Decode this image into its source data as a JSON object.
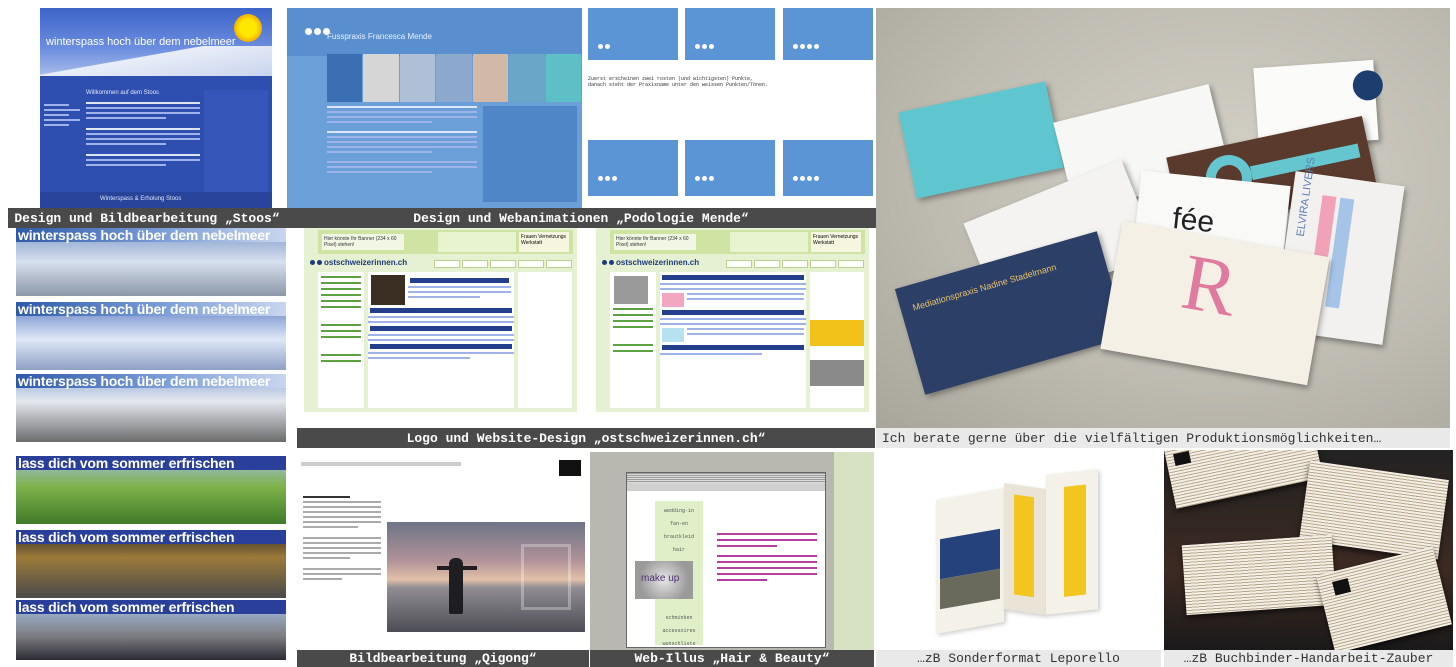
{
  "captions": {
    "stoos": "Design und Bildbearbeitung „Stoos“",
    "podologie": "Design und Webanimationen „Podologie Mende“",
    "ost": "Logo und Website-Design „ostschweizerinnen.ch“",
    "cards": "Ich berate gerne über die vielfältigen Produktionsmöglichkeiten…",
    "qigong": "Bildbearbeitung „Qigong“",
    "hair": "Web-Illus „Hair & Beauty“",
    "lepo": "…zB Sonderformat Leporello",
    "buch": "…zB Buchbinder-Handarbeit-Zauber"
  },
  "stoos_site": {
    "title": "winterspass hoch über dem nebelmeer",
    "welcome": "Willkommen auf dem Stoos",
    "footer": "Winterspass & Erholung Stoos"
  },
  "banners": [
    {
      "text": "winterspass hoch über dem nebelmeer",
      "style": "blue"
    },
    {
      "text": "winterspass hoch über dem nebelmeer",
      "style": "blue"
    },
    {
      "text": "winterspass hoch über dem nebelmeer",
      "style": "blue"
    },
    {
      "text": "lass dich vom sommer erfrischen",
      "style": "bluedk"
    },
    {
      "text": "lass dich vom sommer erfrischen",
      "style": "bluedk"
    },
    {
      "text": "lass dich vom sommer erfrischen",
      "style": "bluedk"
    }
  ],
  "podologie_site": {
    "title": "Fusspraxis Francesca Mende",
    "intro_line1": "Zuerst erscheinen zwei rosten (und wichtigsten) Punkte,",
    "intro_line2": "danach steht der Praxisname unter den weissen Punkten/Tönen."
  },
  "ost_site": {
    "logo": "ostschweizerinnen.ch",
    "banner_placeholder": "Hier könnte Ihr Banner (234 x 60 Pixel) stehen!",
    "event": "Frauen Vernetzungs Werkstatt"
  },
  "cards_text": {
    "fee": "fée",
    "r_letter": "R",
    "elvira": "ELVIRA LIVERS",
    "mediation": "Mediationspraxis Nadine Stadelmann"
  },
  "hair_site": {
    "menu": [
      "wedding-in",
      "fan-en",
      "brautkleid",
      "hair",
      "make up",
      "schminken",
      "accessoires",
      "wunschliste",
      "links"
    ],
    "makeup_label": "make up"
  },
  "colors": {
    "caption_bg": "#4a4a4a",
    "caption_light_bg": "#e9e9e9",
    "stoos_blue": "#2f4fb0",
    "podo_blue": "#6b9fd7",
    "ost_green": "#cfe4a3"
  }
}
